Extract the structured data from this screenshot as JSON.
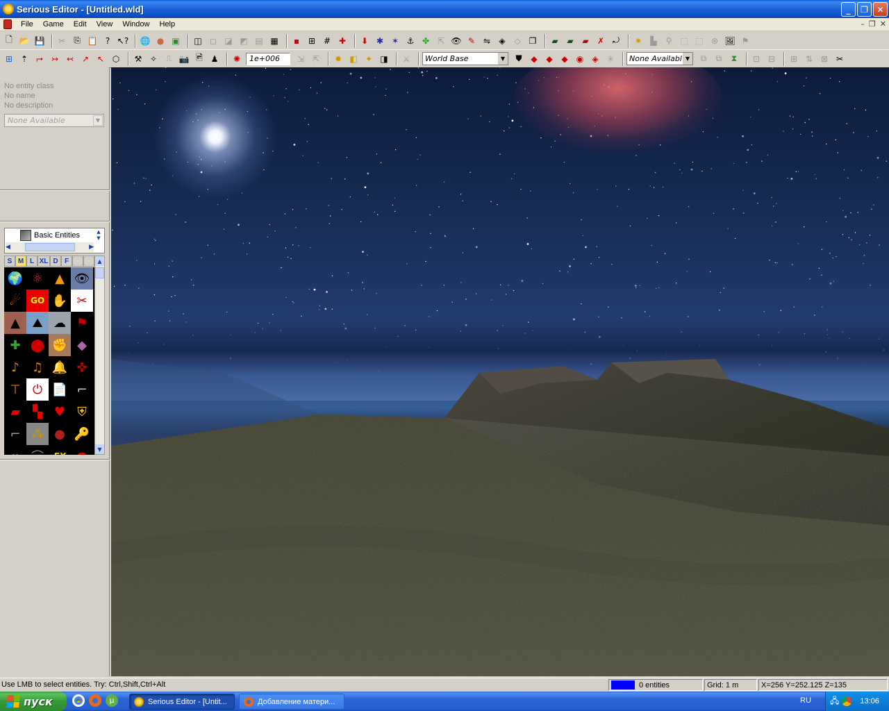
{
  "window": {
    "title": "Serious Editor - [Untitled.wld]",
    "minimize": "_",
    "maximize": "❐",
    "close": "✕"
  },
  "menu": {
    "items": [
      "File",
      "Game",
      "Edit",
      "View",
      "Window",
      "Help"
    ]
  },
  "toolbar2": {
    "grid_value": "1e+006",
    "world_combo": "World Base",
    "avail_combo": "None Available"
  },
  "left_panel": {
    "entity_class": "No entity class",
    "entity_name": "No name",
    "entity_description": "No description",
    "combo": "None Available",
    "tree_node": "Basic Entities",
    "tabs": [
      "S",
      "M",
      "L",
      "XL",
      "D",
      "F"
    ],
    "fx_label": "FX"
  },
  "statusbar": {
    "hint": "Use LMB to select entities. Try: Ctrl,Shift,Ctrl+Alt",
    "entities": "0 entities",
    "grid": "Grid: 1 m",
    "coords": "X=256 Y=252.125 Z=135"
  },
  "taskbar": {
    "start": "пуск",
    "tasks": [
      "Serious Editor - [Untit...",
      "Добавление матери..."
    ],
    "lang": "RU",
    "clock": "13:06"
  },
  "colors": {
    "titlebar": "#0a5bd6",
    "start": "#379a37",
    "tray": "#0e7fd8",
    "entity_blue": "#0000ff"
  }
}
